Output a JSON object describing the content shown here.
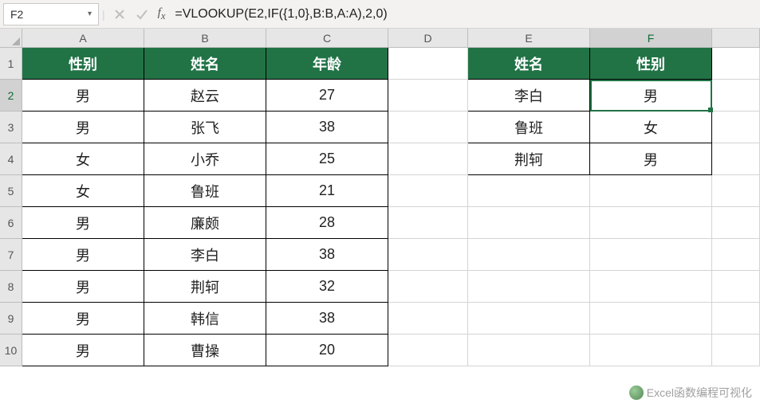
{
  "nameBox": {
    "value": "F2"
  },
  "formulaBar": {
    "formula": "=VLOOKUP(E2,IF({1,0},B:B,A:A),2,0)"
  },
  "columns": [
    "A",
    "B",
    "C",
    "D",
    "E",
    "F"
  ],
  "rowCount": 10,
  "selectedCol": "F",
  "selectedRow": 2,
  "table1": {
    "headers": {
      "A": "性别",
      "B": "姓名",
      "C": "年龄"
    },
    "rows": [
      {
        "A": "男",
        "B": "赵云",
        "C": "27"
      },
      {
        "A": "男",
        "B": "张飞",
        "C": "38"
      },
      {
        "A": "女",
        "B": "小乔",
        "C": "25"
      },
      {
        "A": "女",
        "B": "鲁班",
        "C": "21"
      },
      {
        "A": "男",
        "B": "廉颇",
        "C": "28"
      },
      {
        "A": "男",
        "B": "李白",
        "C": "38"
      },
      {
        "A": "男",
        "B": "荆轲",
        "C": "32"
      },
      {
        "A": "男",
        "B": "韩信",
        "C": "38"
      },
      {
        "A": "男",
        "B": "曹操",
        "C": "20"
      }
    ]
  },
  "table2": {
    "headers": {
      "E": "姓名",
      "F": "性别"
    },
    "rows": [
      {
        "E": "李白",
        "F": "男"
      },
      {
        "E": "鲁班",
        "F": "女"
      },
      {
        "E": "荆轲",
        "F": "男"
      }
    ]
  },
  "watermark": {
    "text": "Excel函数编程可视化"
  }
}
